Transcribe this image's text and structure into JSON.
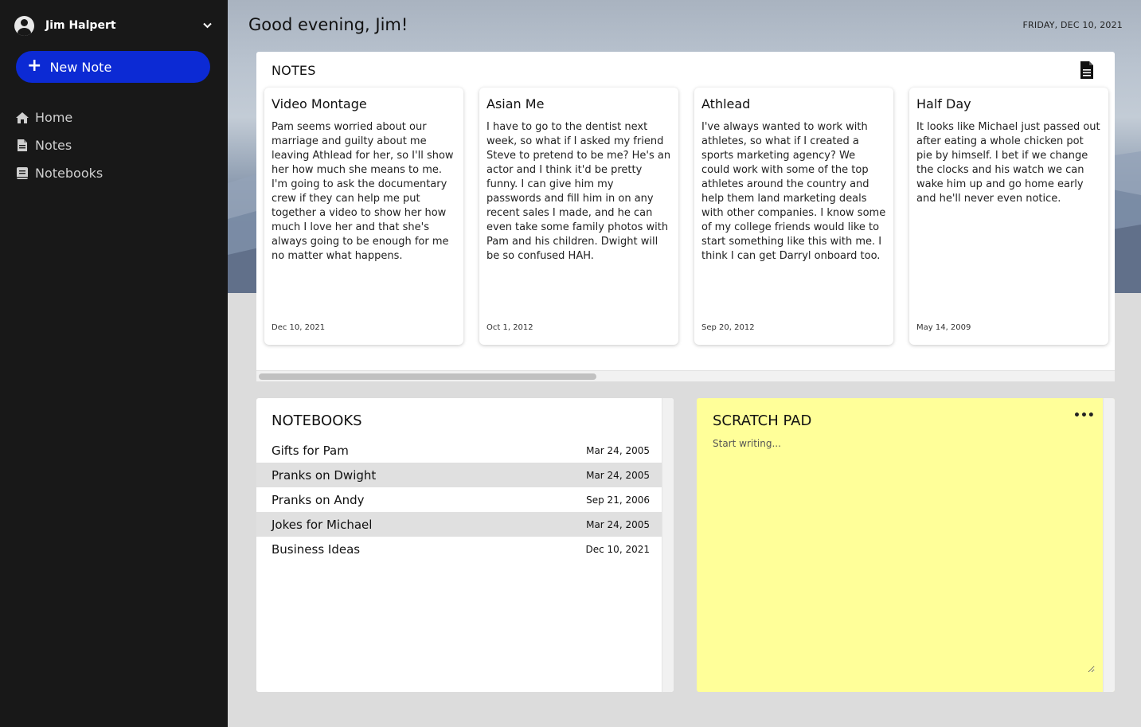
{
  "user": {
    "name": "Jim Halpert"
  },
  "sidebar": {
    "new_note_label": "New Note",
    "items": [
      {
        "label": "Home",
        "icon": "home-icon"
      },
      {
        "label": "Notes",
        "icon": "note-icon"
      },
      {
        "label": "Notebooks",
        "icon": "notebook-icon"
      }
    ]
  },
  "header": {
    "greeting": "Good evening, Jim!",
    "date": "FRIDAY, DEC 10, 2021"
  },
  "notes": {
    "title": "NOTES",
    "cards": [
      {
        "title": "Video Montage",
        "body": "Pam seems worried about our marriage and guilty about me leaving Athlead for her, so I'll show her how much she means to me. I'm going to ask the documentary crew if they can help me put together a video to show her how much I love her and that she's always going to be enough for me no matter what happens.",
        "date": "Dec 10, 2021"
      },
      {
        "title": "Asian Me",
        "body": "I have to go to the dentist next week, so what if I asked my friend Steve to pretend to be me? He's an actor and I think it'd be pretty funny. I can give him my passwords and fill him in on any recent sales I made, and he can even take some family photos with Pam and his children. Dwight will be so confused HAH.",
        "date": "Oct 1, 2012"
      },
      {
        "title": "Athlead",
        "body": "I've always wanted to work with athletes, so what if I created a sports marketing agency? We could work with some of the top athletes around the country and help them land marketing deals with other companies. I know some of my college friends would like to start something like this with me. I think I can get Darryl onboard too.",
        "date": "Sep 20, 2012"
      },
      {
        "title": "Half Day",
        "body": "It looks like Michael just passed out after eating a whole chicken pot pie by himself. I bet if we change the clocks and his watch we can wake him up and go home early and he'll never even notice.",
        "date": "May 14, 2009"
      }
    ]
  },
  "notebooks": {
    "title": "NOTEBOOKS",
    "items": [
      {
        "name": "Gifts for Pam",
        "date": "Mar 24, 2005"
      },
      {
        "name": "Pranks on Dwight",
        "date": "Mar 24, 2005"
      },
      {
        "name": "Pranks on Andy",
        "date": "Sep 21, 2006"
      },
      {
        "name": "Jokes for Michael",
        "date": "Mar 24, 2005"
      },
      {
        "name": "Business Ideas",
        "date": "Dec 10, 2021"
      }
    ]
  },
  "scratch_pad": {
    "title": "SCRATCH PAD",
    "menu_label": "•••",
    "placeholder": "Start writing..."
  },
  "colors": {
    "sidebar_bg": "#181818",
    "accent": "#0c2ad4",
    "scratch_bg": "#ffff99"
  }
}
